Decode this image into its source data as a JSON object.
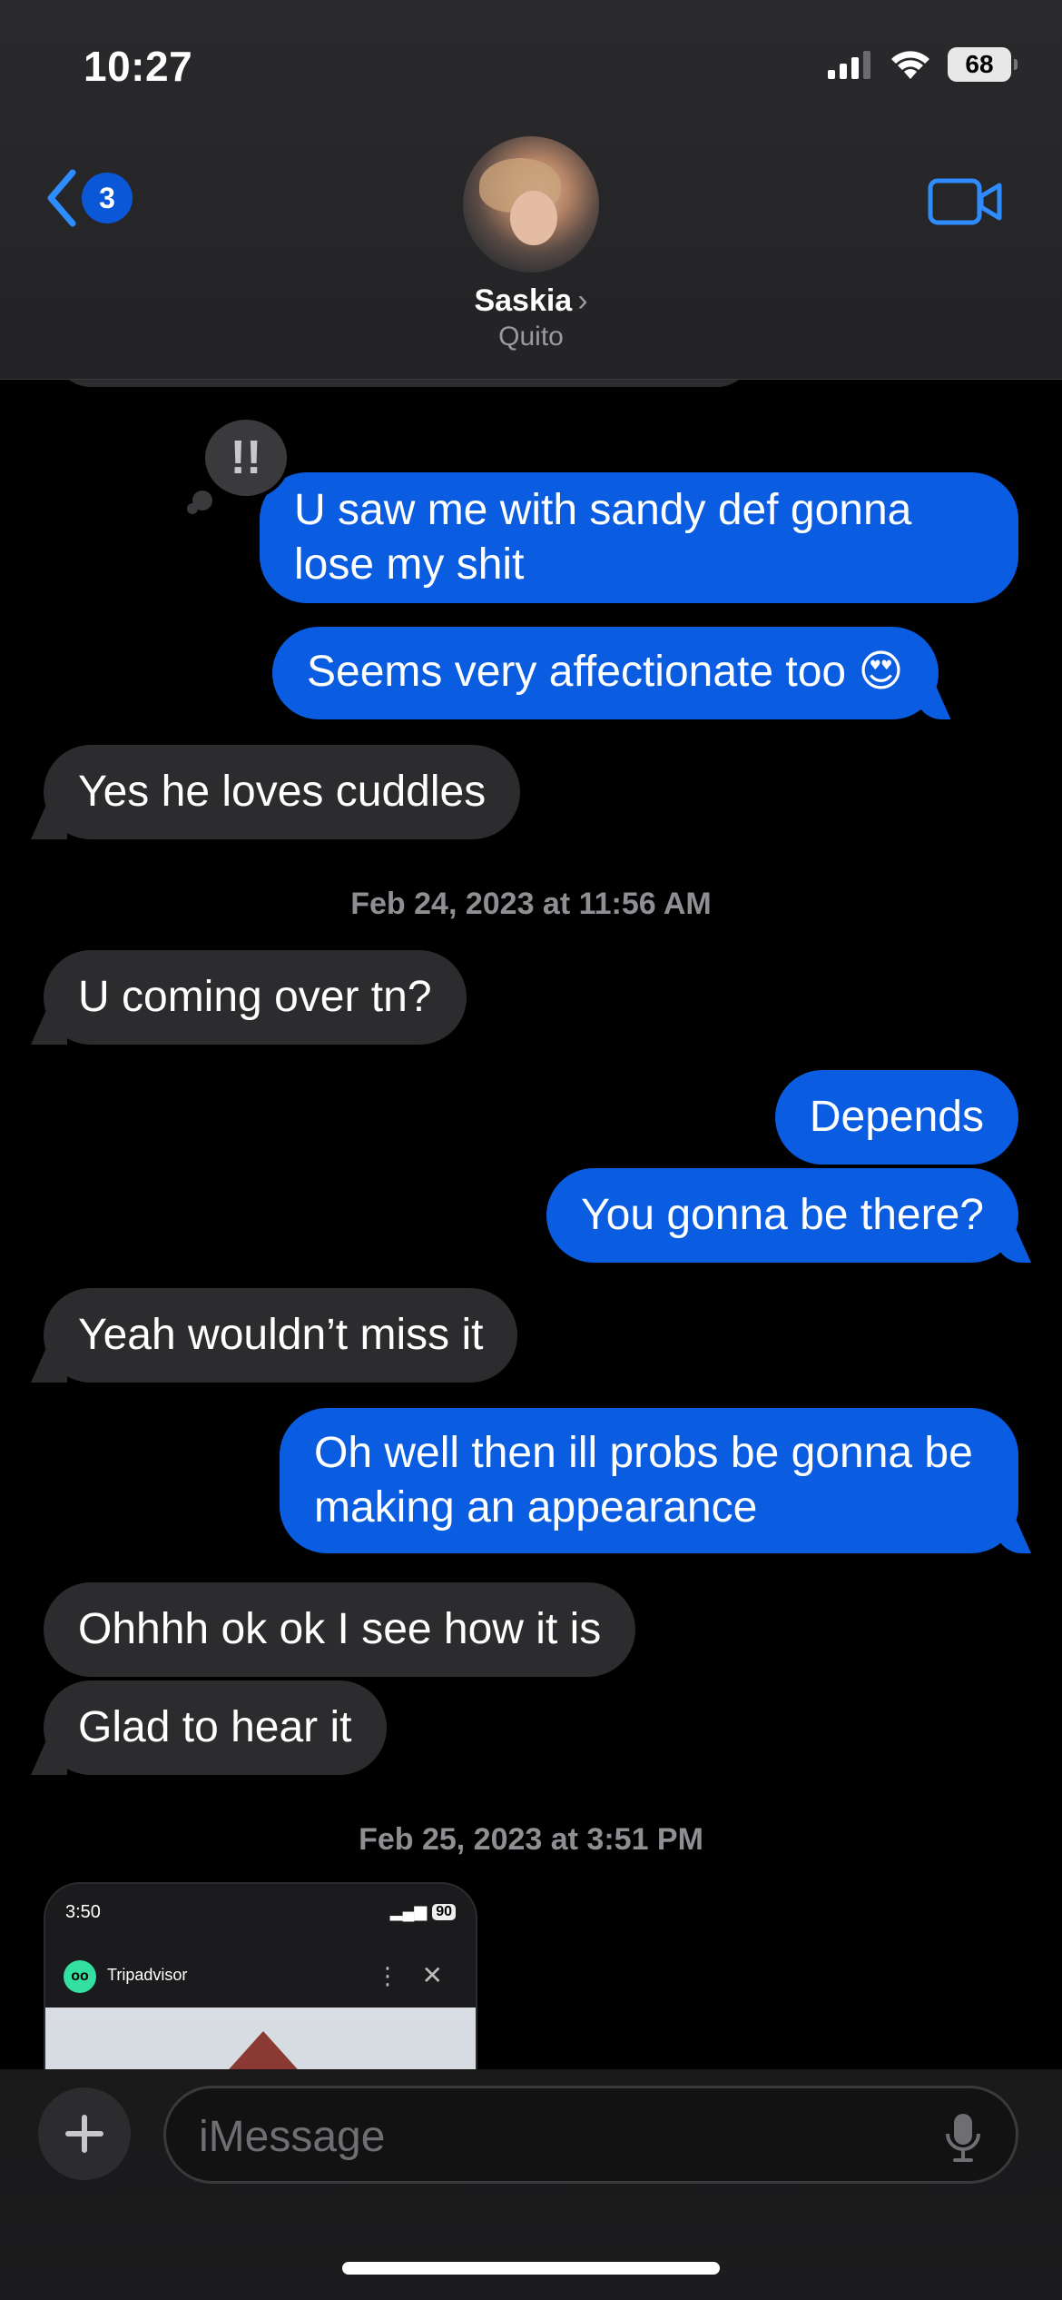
{
  "status_bar": {
    "time": "10:27",
    "battery": "68",
    "icons": [
      "cellular-signal-icon",
      "wifi-icon",
      "battery-icon"
    ]
  },
  "header": {
    "back_badge": "3",
    "contact_name": "Saskia",
    "contact_subtitle": "Quito",
    "icons": [
      "chevron-left-icon",
      "chevron-right-icon",
      "video-camera-icon"
    ]
  },
  "colors": {
    "sent_bubble": "#0A5CE0",
    "received_bubble": "#2C2C2E",
    "accent": "#2F8CFF"
  },
  "tapback": {
    "glyph": "!!",
    "icon": "exclamation-tapback-icon"
  },
  "messages": [
    {
      "from": "me",
      "text": "U saw me with sandy def gonna lose my shit"
    },
    {
      "from": "me",
      "text": "Seems very affectionate too 😍"
    },
    {
      "from": "them",
      "text": "Yes he loves cuddles"
    },
    {
      "from": "them",
      "text": "U coming over tn?"
    },
    {
      "from": "me",
      "text": "Depends"
    },
    {
      "from": "me",
      "text": "You gonna be there?"
    },
    {
      "from": "them",
      "text": "Yeah wouldn’t miss it"
    },
    {
      "from": "me",
      "text": "Oh well then ill probs be gonna be making an appearance"
    },
    {
      "from": "them",
      "text": "Ohhhh ok ok I see how it is"
    },
    {
      "from": "them",
      "text": "Glad to hear it"
    }
  ],
  "timestamps": [
    "Feb 24, 2023 at 11:56 AM",
    "Feb 25, 2023 at 3:51 PM"
  ],
  "attachment": {
    "time": "3:50",
    "battery": "90",
    "app_title": "Tripadvisor",
    "more": "⋮",
    "close": "✕"
  },
  "composer": {
    "placeholder": "iMessage",
    "icons": [
      "plus-icon",
      "microphone-icon"
    ]
  }
}
